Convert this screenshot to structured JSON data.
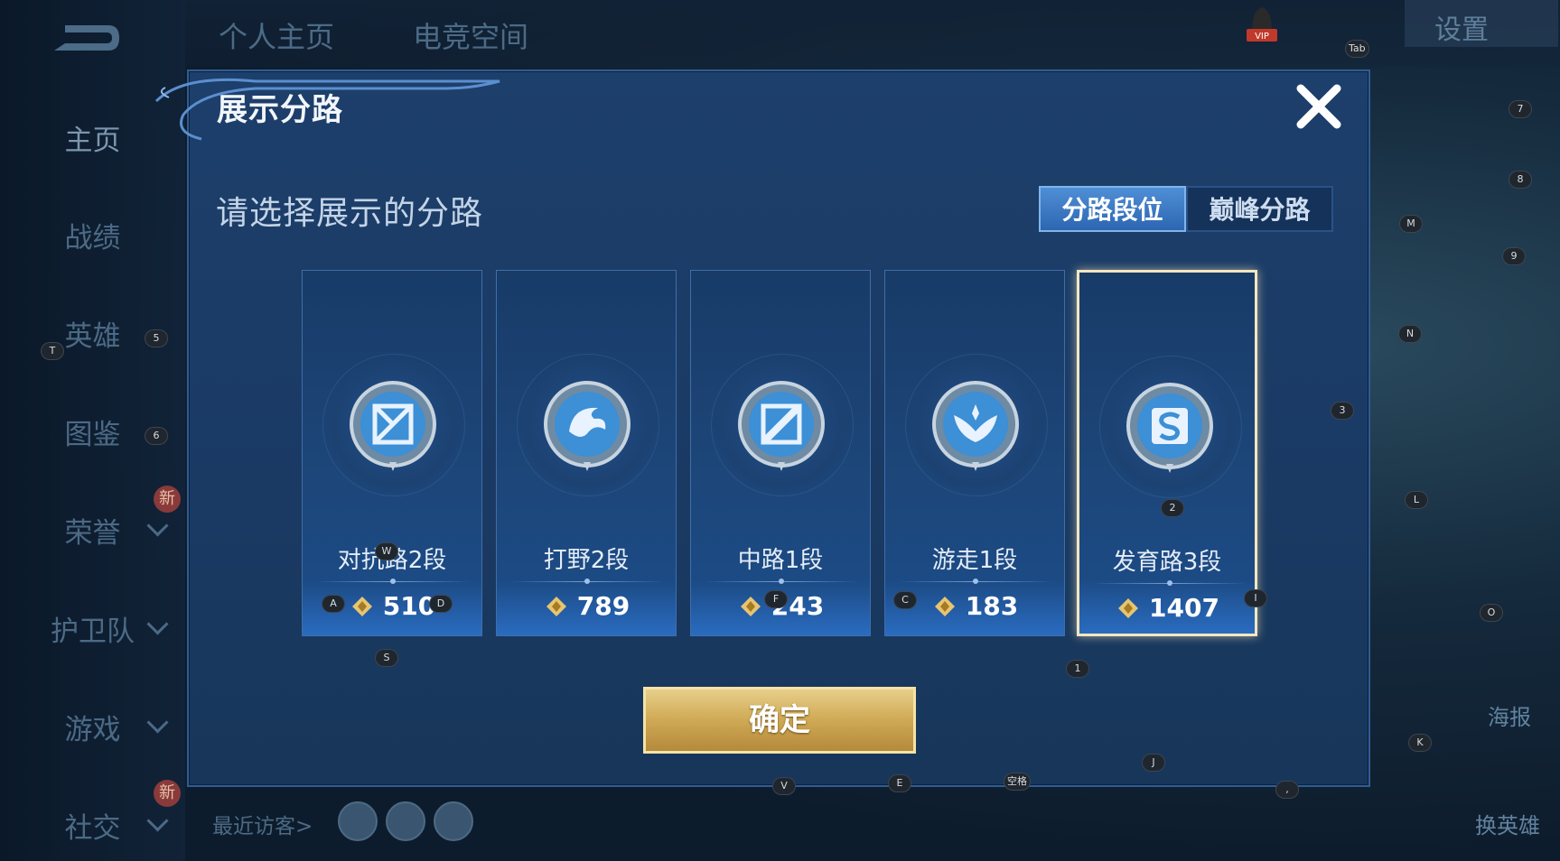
{
  "top_tabs": [
    "个人主页",
    "电竞空间"
  ],
  "nav": {
    "items": [
      {
        "label": "主页"
      },
      {
        "label": "战绩"
      },
      {
        "label": "英雄"
      },
      {
        "label": "图鉴"
      },
      {
        "label": "荣誉"
      },
      {
        "label": "护卫队"
      },
      {
        "label": "游戏"
      },
      {
        "label": "社交"
      }
    ],
    "new_badge": "新"
  },
  "visitors_label": "最近访客>",
  "settings_label": "设置",
  "vip_label": "VIP",
  "right_labels": {
    "poster": "海报",
    "change_hero": "换英雄"
  },
  "modal": {
    "title": "展示分路",
    "prompt": "请选择展示的分路",
    "segments": {
      "lane_rank": "分路段位",
      "peak_lane": "巅峰分路",
      "active": "lane_rank"
    },
    "cards": [
      {
        "name": "对抗路2段",
        "score": "510",
        "icon": "clash-lane-emblem-icon",
        "selected": false
      },
      {
        "name": "打野2段",
        "score": "789",
        "icon": "jungle-dragon-emblem-icon",
        "selected": false
      },
      {
        "name": "中路1段",
        "score": "243",
        "icon": "mid-lane-emblem-icon",
        "selected": false
      },
      {
        "name": "游走1段",
        "score": "183",
        "icon": "roam-wings-emblem-icon",
        "selected": false
      },
      {
        "name": "发育路3段",
        "score": "1407",
        "icon": "farm-lane-emblem-icon",
        "selected": true
      }
    ],
    "confirm_label": "确定"
  },
  "key_hints": {
    "tab": "Tab",
    "space": "空格",
    "comma": ",",
    "k1": "1",
    "k2": "2",
    "k3": "3",
    "k5": "5",
    "k6": "6",
    "k7": "7",
    "k8": "8",
    "k9": "9",
    "a": "A",
    "c": "C",
    "d": "D",
    "e": "E",
    "f": "F",
    "i": "I",
    "j": "J",
    "k": "K",
    "l": "L",
    "m": "M",
    "n": "N",
    "o": "O",
    "s": "S",
    "t": "T",
    "v": "V",
    "w": "W"
  },
  "colors": {
    "accent": "#2d66b1",
    "selected_border": "#f3e6c2",
    "confirm_gold": "#cfa955"
  }
}
